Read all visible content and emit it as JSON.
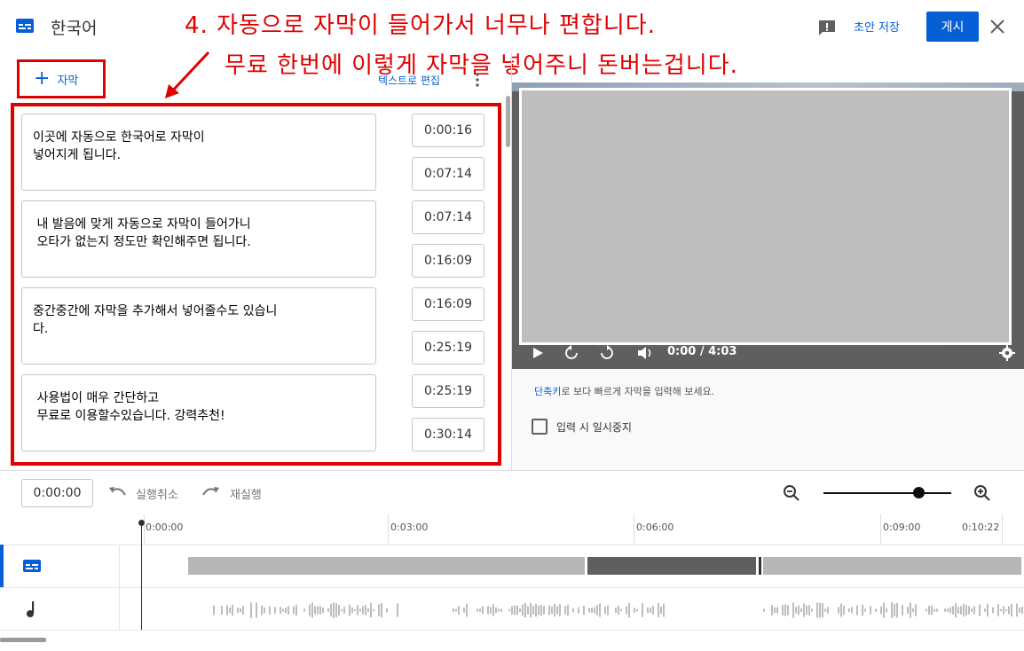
{
  "header": {
    "language_title": "한국어",
    "draft_save_label": "초안 저장",
    "publish_label": "게시"
  },
  "annotation": {
    "line1": "4. 자동으로 자막이 들어가서 너무나 편합니다.",
    "line2": "무료 한번에 이렇게 자막을 넣어주니 돈버는겁니다.",
    "color": "#e00000"
  },
  "editor": {
    "add_caption_label": "자막",
    "edit_as_text_label": "텍스트로 편집",
    "cues": [
      {
        "text": "이곳에 자동으로 한국어로 자막이\n넣어지게 됩니다.",
        "start": "0:00:16",
        "end": "0:07:14"
      },
      {
        "text": " 내 발음에 맞게 자동으로 자막이 들어가니\n 오타가 없는지 정도만 확인해주면 됩니다.",
        "start": "0:07:14",
        "end": "0:16:09"
      },
      {
        "text": "중간중간에 자막을 추가해서 넣어줄수도 있습니\n다.",
        "start": "0:16:09",
        "end": "0:25:19"
      },
      {
        "text": " 사용법이 매우 간단하고\n 무료로 이용할수있습니다. 강력추천!",
        "start": "0:25:19",
        "end": "0:30:14"
      }
    ]
  },
  "player": {
    "time_readout": "0:00 / 4:03",
    "progress_fraction": 0.0
  },
  "shortcuts": {
    "link_text": "단축키",
    "rest_text": "로 보다 빠르게 자막을 입력해 보세요.",
    "pause_label": "입력 시 일시중지",
    "pause_checked": false
  },
  "timeline": {
    "current_time": "0:00:00",
    "undo_label": "실행취소",
    "redo_label": "재실행",
    "ruler_labels": [
      "0:00:00",
      "0:03:00",
      "0:06:00",
      "0:09:00",
      "0:10:22"
    ],
    "zoom_level_fraction": 0.7
  },
  "colors": {
    "accent": "#065fd4",
    "annotation_red": "#e00000",
    "selected_segment": "#5f5f5f",
    "segment": "#b7b7b7"
  }
}
